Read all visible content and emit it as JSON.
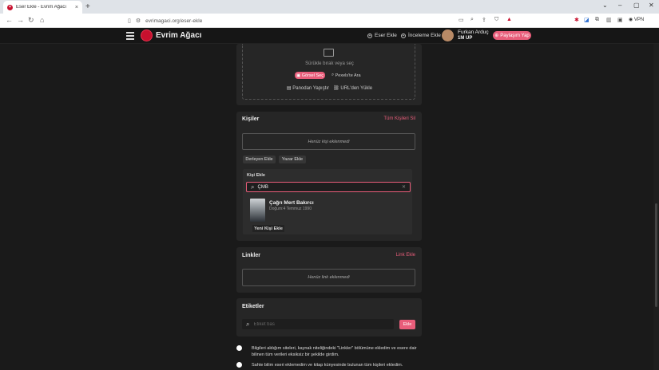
{
  "browser": {
    "tab_title": "Eser Ekle - Evrim Ağacı",
    "url": "evrimagaci.org/eser-ekle",
    "vpn_label": "VPN"
  },
  "site": {
    "logo_text": "Evrim Ağacı",
    "nav": [
      "Eser Ekle",
      "İnceleme Ekle"
    ],
    "user_name": "Furkan Arduç",
    "user_sub": "1M UP",
    "share_label": "Paylaşım Yap"
  },
  "image_upload": {
    "drop_text": "Sürükle bırak veya seç",
    "pick_label": "Görsel Seç",
    "pexels_label": "Pexels'te Ara",
    "paste_label": "Panodan Yapıştır",
    "url_label": "URL'den Yükle"
  },
  "people": {
    "title": "Kişiler",
    "remove_all": "Tüm Kişileri Sil",
    "empty": "Henüz kişi eklenmedi",
    "tabs": [
      "Derleyen Ekle",
      "Yazar Ekle"
    ],
    "add_label": "Kişi Ekle",
    "search_value": "ÇMB",
    "result_name": "Çağrı Mert Bakırcı",
    "result_sub": "Doğum:4 Temmuz 1990",
    "new_person": "Yeni Kişi Ekle"
  },
  "links": {
    "title": "Linkler",
    "add_link": "Link Ekle",
    "empty": "Henüz link eklenmedi"
  },
  "tags": {
    "title": "Etiketler",
    "placeholder": "Etiket bas",
    "add_label": "Ekle"
  },
  "confirmations": [
    "Bilgileri aldığım siteleri, kaynak niteliğindeki \"Linkler\" bölümüne ekledim ve esere dair bilinen tüm verileri eksiksiz bir şekilde girdim.",
    "Sahte bilim eseri eklemedim ve kitap künyesinde bulunan tüm kişileri ekledim."
  ],
  "colors": {
    "accent": "#e85d7a",
    "brand": "#c8102e",
    "card": "#262626",
    "page_bg": "#1a1a1a"
  }
}
